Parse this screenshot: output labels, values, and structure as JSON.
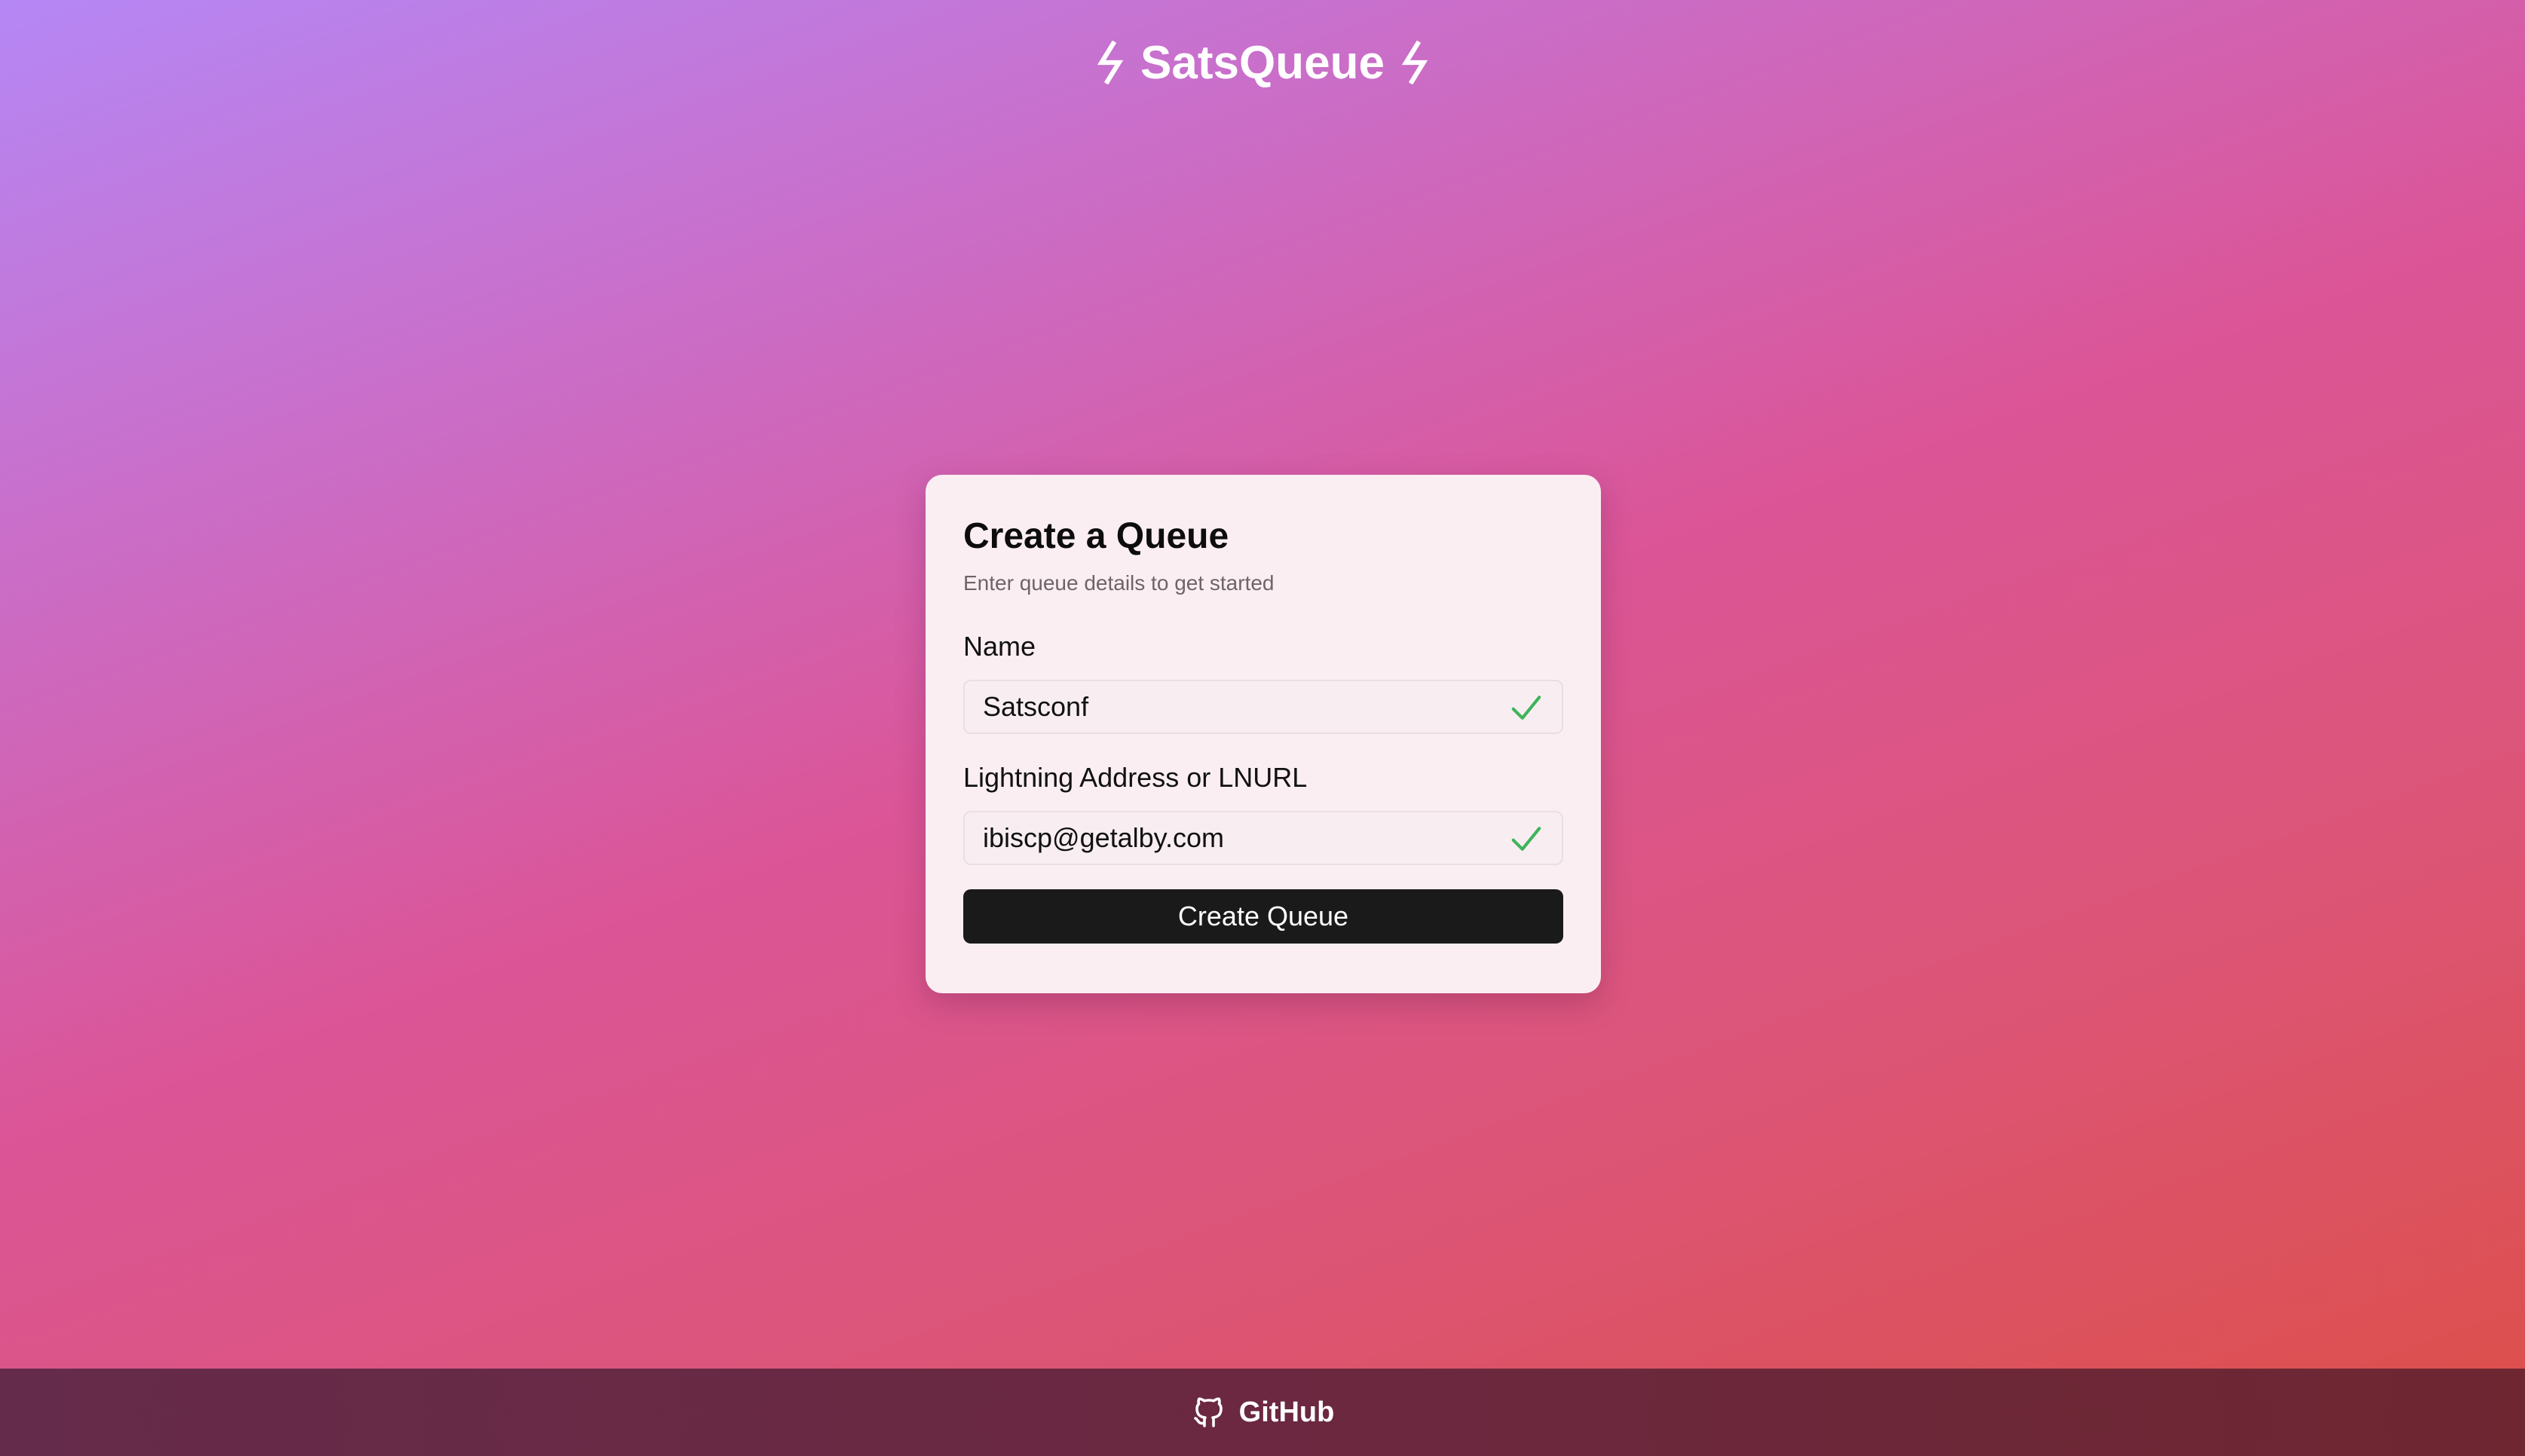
{
  "header": {
    "title": "SatsQueue",
    "left_icon": "lightning-bolt-icon",
    "right_icon": "lightning-bolt-icon"
  },
  "form": {
    "title": "Create a Queue",
    "subtitle": "Enter queue details to get started",
    "fields": [
      {
        "label": "Name",
        "value": "Satsconf",
        "status_icon": "check-icon",
        "valid": true
      },
      {
        "label": "Lightning Address or LNURL",
        "value": "ibiscp@getalby.com",
        "status_icon": "check-icon",
        "valid": true
      }
    ],
    "submit_label": "Create Queue"
  },
  "footer": {
    "link_label": "GitHub",
    "icon": "github-icon"
  },
  "colors": {
    "gradient_start": "#b587f5",
    "gradient_mid": "#db5597",
    "gradient_end": "#dd4f48",
    "card_background": "#fbeef3",
    "button_background": "#1a1a1a",
    "check_green": "#3fb45a",
    "footer_background": "#6b2840"
  }
}
